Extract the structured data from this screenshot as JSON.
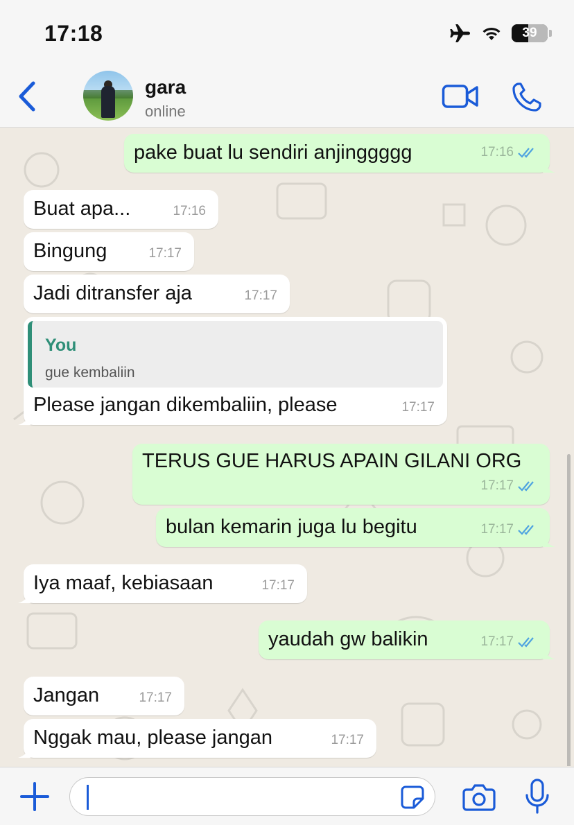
{
  "status_bar": {
    "time": "17:18",
    "battery": "39",
    "icons": [
      "airplane-icon",
      "wifi-icon",
      "battery-icon"
    ]
  },
  "header": {
    "name": "gara",
    "status": "online",
    "icons": [
      "back-chevron-icon",
      "video-call-icon",
      "phone-call-icon"
    ]
  },
  "messages": [
    {
      "dir": "out",
      "text": "pake buat lu sendiri anjinggggg",
      "time": "17:16",
      "read": true
    },
    {
      "dir": "in",
      "text": "Buat apa...",
      "time": "17:16"
    },
    {
      "dir": "in",
      "text": "Bingung",
      "time": "17:17"
    },
    {
      "dir": "in",
      "text": "Jadi ditransfer aja",
      "time": "17:17"
    },
    {
      "dir": "in",
      "text": "Please jangan dikembaliin, please",
      "time": "17:17",
      "reply": {
        "author": "You",
        "text": "gue kembaliin"
      }
    },
    {
      "dir": "out",
      "text": "TERUS GUE HARUS APAIN GILANI ORG",
      "time": "17:17",
      "read": true
    },
    {
      "dir": "out",
      "text": "bulan kemarin juga lu begitu",
      "time": "17:17",
      "read": true
    },
    {
      "dir": "in",
      "text": "Iya maaf, kebiasaan",
      "time": "17:17"
    },
    {
      "dir": "out",
      "text": "yaudah gw balikin",
      "time": "17:17",
      "read": true
    },
    {
      "dir": "in",
      "text": "Jangan",
      "time": "17:17"
    },
    {
      "dir": "in",
      "text": "Nggak mau, please jangan",
      "time": "17:17"
    }
  ],
  "composer": {
    "value": "",
    "icons": [
      "plus-icon",
      "sticker-icon",
      "camera-icon",
      "microphone-icon"
    ]
  },
  "colors": {
    "accent": "#1a5bd8",
    "outgoing_bubble": "#d9fdd3",
    "incoming_bubble": "#ffffff",
    "chat_bg": "#efeae2",
    "reply_author": "#2f8f78",
    "read_ticks": "#4fa3e0"
  }
}
